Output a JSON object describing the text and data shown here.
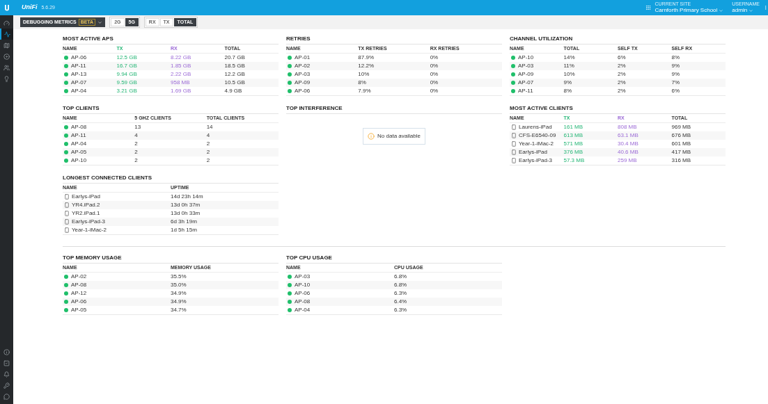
{
  "header": {
    "product": "UniFi",
    "version": "5.6.29",
    "site_label": "CURRENT SITE",
    "site": "Carnforth Primary School",
    "user_label": "USERNAME",
    "user": "admin"
  },
  "sidebar": {
    "top": [
      {
        "selected": false
      },
      {
        "selected": true
      },
      {
        "selected": false
      },
      {
        "selected": false
      },
      {
        "selected": false
      },
      {
        "selected": false
      }
    ],
    "bottom": [
      {
        "selected": false
      },
      {
        "selected": false
      },
      {
        "selected": false
      },
      {
        "selected": false
      },
      {
        "selected": false
      }
    ]
  },
  "toolbar": {
    "metrics": {
      "label": "DEBUGGING METRICS",
      "badge": "BETA"
    },
    "bands": [
      {
        "label": "2G",
        "selected": false
      },
      {
        "label": "5G",
        "selected": true
      }
    ],
    "traffic": [
      {
        "label": "RX",
        "selected": false
      },
      {
        "label": "TX",
        "selected": false
      },
      {
        "label": "TOTAL",
        "selected": true
      }
    ]
  },
  "columns": [
    [
      {
        "title": "MOST ACTIVE APS",
        "columns": [
          {
            "label": "NAME",
            "kind": "plain"
          },
          {
            "label": "TX",
            "kind": "tx"
          },
          {
            "label": "RX",
            "kind": "rx"
          },
          {
            "label": "TOTAL",
            "kind": "plain"
          }
        ],
        "rows": [
          {
            "kind": "ap",
            "cells": [
              "AP-06",
              "12.5 GB",
              "8.22 GB",
              "20.7 GB"
            ]
          },
          {
            "kind": "ap",
            "cells": [
              "AP-11",
              "16.7 GB",
              "1.85 GB",
              "18.5 GB"
            ]
          },
          {
            "kind": "ap",
            "cells": [
              "AP-13",
              "9.94 GB",
              "2.22 GB",
              "12.2 GB"
            ]
          },
          {
            "kind": "ap",
            "cells": [
              "AP-07",
              "9.59 GB",
              "958 MB",
              "10.5 GB"
            ]
          },
          {
            "kind": "ap",
            "cells": [
              "AP-04",
              "3.21 GB",
              "1.69 GB",
              "4.9 GB"
            ]
          }
        ]
      },
      {
        "title": "TOP CLIENTS",
        "columns": [
          {
            "label": "NAME",
            "kind": "plain"
          },
          {
            "label": "5 GHZ CLIENTS",
            "kind": "plain"
          },
          {
            "label": "TOTAL CLIENTS",
            "kind": "plain"
          }
        ],
        "rows": [
          {
            "kind": "ap",
            "cells": [
              "AP-08",
              "13",
              "14"
            ]
          },
          {
            "kind": "ap",
            "cells": [
              "AP-11",
              "4",
              "4"
            ]
          },
          {
            "kind": "ap",
            "cells": [
              "AP-04",
              "2",
              "2"
            ]
          },
          {
            "kind": "ap",
            "cells": [
              "AP-05",
              "2",
              "2"
            ]
          },
          {
            "kind": "ap",
            "cells": [
              "AP-10",
              "2",
              "2"
            ]
          }
        ]
      },
      {
        "title": "LONGEST CONNECTED CLIENTS",
        "columns": [
          {
            "label": "NAME",
            "kind": "plain"
          },
          {
            "label": "UPTIME",
            "kind": "plain"
          }
        ],
        "rows": [
          {
            "kind": "client",
            "cells": [
              "Earlys-iPad",
              "14d 23h 14m"
            ]
          },
          {
            "kind": "client",
            "cells": [
              "YR4.iPad.2",
              "13d 0h 37m"
            ]
          },
          {
            "kind": "client",
            "cells": [
              "YR2.iPad.1",
              "13d 0h 33m"
            ]
          },
          {
            "kind": "client",
            "cells": [
              "Earlys-iPad-3",
              "6d 3h 19m"
            ]
          },
          {
            "kind": "client",
            "cells": [
              "Year-1-iMac-2",
              "1d 5h 15m"
            ]
          }
        ]
      }
    ],
    [
      {
        "title": "RETRIES",
        "columns": [
          {
            "label": "NAME",
            "kind": "plain"
          },
          {
            "label": "TX RETRIES",
            "kind": "plain"
          },
          {
            "label": "RX RETRIES",
            "kind": "plain"
          }
        ],
        "rows": [
          {
            "kind": "ap",
            "cells": [
              "AP-01",
              "87.9%",
              "0%"
            ]
          },
          {
            "kind": "ap",
            "cells": [
              "AP-02",
              "12.2%",
              "0%"
            ]
          },
          {
            "kind": "ap",
            "cells": [
              "AP-03",
              "10%",
              "0%"
            ]
          },
          {
            "kind": "ap",
            "cells": [
              "AP-09",
              "8%",
              "0%"
            ]
          },
          {
            "kind": "ap",
            "cells": [
              "AP-06",
              "7.9%",
              "0%"
            ]
          }
        ]
      },
      {
        "title": "TOP INTERFERENCE",
        "empty": "No data available"
      }
    ],
    [
      {
        "title": "CHANNEL UTILIZATION",
        "columns": [
          {
            "label": "NAME",
            "kind": "plain"
          },
          {
            "label": "TOTAL",
            "kind": "plain"
          },
          {
            "label": "SELF TX",
            "kind": "plain"
          },
          {
            "label": "SELF RX",
            "kind": "plain"
          }
        ],
        "rows": [
          {
            "kind": "ap",
            "cells": [
              "AP-10",
              "14%",
              "6%",
              "8%"
            ]
          },
          {
            "kind": "ap",
            "cells": [
              "AP-03",
              "11%",
              "2%",
              "9%"
            ]
          },
          {
            "kind": "ap",
            "cells": [
              "AP-09",
              "10%",
              "2%",
              "9%"
            ]
          },
          {
            "kind": "ap",
            "cells": [
              "AP-07",
              "9%",
              "2%",
              "7%"
            ]
          },
          {
            "kind": "ap",
            "cells": [
              "AP-11",
              "8%",
              "2%",
              "6%"
            ]
          }
        ]
      },
      {
        "title": "MOST ACTIVE CLIENTS",
        "columns": [
          {
            "label": "NAME",
            "kind": "plain"
          },
          {
            "label": "TX",
            "kind": "tx"
          },
          {
            "label": "RX",
            "kind": "rx"
          },
          {
            "label": "TOTAL",
            "kind": "plain"
          }
        ],
        "rows": [
          {
            "kind": "client",
            "cells": [
              "Laurens-iPad",
              "161 MB",
              "808 MB",
              "969 MB"
            ]
          },
          {
            "kind": "client",
            "cells": [
              "CFS-E6540-09",
              "613 MB",
              "63.1 MB",
              "676 MB"
            ]
          },
          {
            "kind": "client",
            "cells": [
              "Year-1-iMac-2",
              "571 MB",
              "30.4 MB",
              "601 MB"
            ]
          },
          {
            "kind": "client",
            "cells": [
              "Earlys-iPad",
              "376 MB",
              "40.6 MB",
              "417 MB"
            ]
          },
          {
            "kind": "client",
            "cells": [
              "Earlys-iPad-3",
              "57.3 MB",
              "259 MB",
              "316 MB"
            ]
          }
        ]
      }
    ]
  ],
  "bottom_sections": [
    {
      "title": "TOP MEMORY USAGE",
      "columns": [
        {
          "label": "NAME",
          "kind": "plain"
        },
        {
          "label": "MEMORY USAGE",
          "kind": "plain"
        }
      ],
      "rows": [
        {
          "kind": "ap",
          "cells": [
            "AP-02",
            "35.5%"
          ]
        },
        {
          "kind": "ap",
          "cells": [
            "AP-08",
            "35.0%"
          ]
        },
        {
          "kind": "ap",
          "cells": [
            "AP-12",
            "34.9%"
          ]
        },
        {
          "kind": "ap",
          "cells": [
            "AP-06",
            "34.9%"
          ]
        },
        {
          "kind": "ap",
          "cells": [
            "AP-05",
            "34.7%"
          ]
        }
      ]
    },
    {
      "title": "TOP CPU USAGE",
      "columns": [
        {
          "label": "NAME",
          "kind": "plain"
        },
        {
          "label": "CPU USAGE",
          "kind": "plain"
        }
      ],
      "rows": [
        {
          "kind": "ap",
          "cells": [
            "AP-03",
            "6.8%"
          ]
        },
        {
          "kind": "ap",
          "cells": [
            "AP-10",
            "6.8%"
          ]
        },
        {
          "kind": "ap",
          "cells": [
            "AP-06",
            "6.3%"
          ]
        },
        {
          "kind": "ap",
          "cells": [
            "AP-08",
            "6.4%"
          ]
        },
        {
          "kind": "ap",
          "cells": [
            "AP-04",
            "6.3%"
          ]
        }
      ]
    }
  ]
}
